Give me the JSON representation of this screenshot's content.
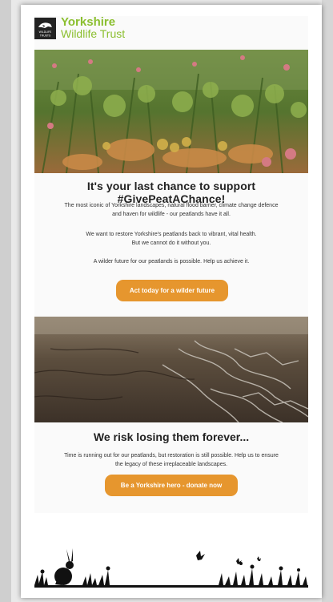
{
  "brand": {
    "name_line1": "Yorkshire",
    "name_line2": "Wildlife Trust",
    "mark_line1": "WILDLIFE",
    "mark_line2": "TRUSTS",
    "color": "#8bbf2f"
  },
  "section1": {
    "heading": "It's your last chance to support #GivePeatAChance!",
    "para1_line1": "The most iconic of Yorkshire landscapes, natural flood barrier, climate change defence",
    "para1_line2": "and haven for wildlife - our peatlands have it all.",
    "para2_line1": "We want to restore Yorkshire's peatlands back to vibrant, vital health.",
    "para2_line2": "But we cannot do it without you.",
    "para3": "A wilder future for our peatlands is possible. Help us achieve it.",
    "button": "Act today for a wilder future"
  },
  "section2": {
    "heading": "We risk losing them forever...",
    "para_line1": "Time is running out for our peatlands, but restoration is still possible. Help us to ensure",
    "para_line2": "the legacy of these irreplaceable landscapes.",
    "button": "Be a Yorkshire hero - donate now"
  },
  "colors": {
    "button": "#e6962e",
    "heading": "#222222"
  }
}
